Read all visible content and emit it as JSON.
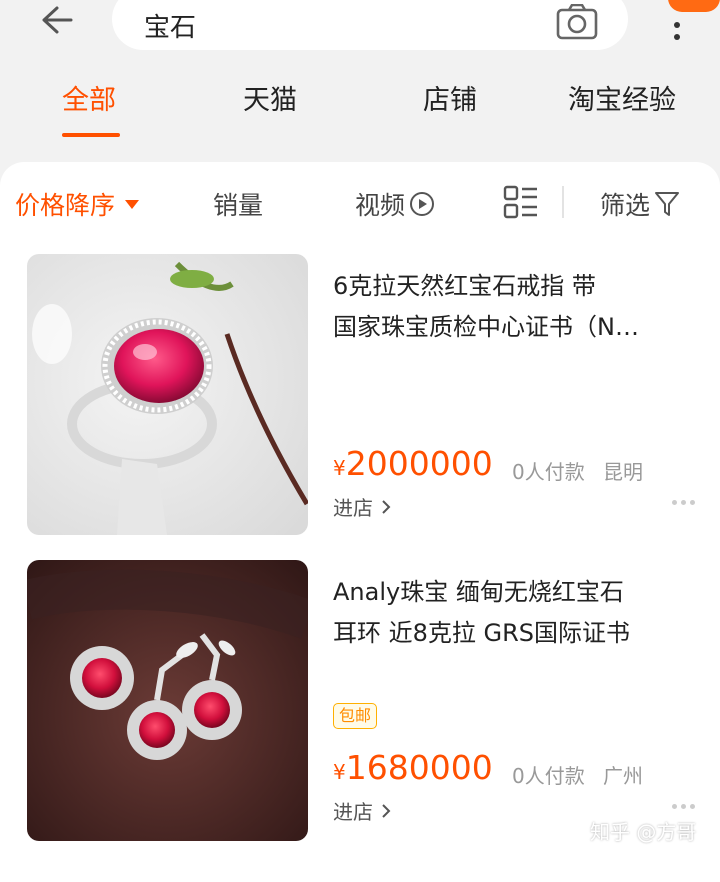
{
  "search": {
    "query": "宝石"
  },
  "icons": {
    "back": "arrow-left-icon",
    "camera": "camera-icon",
    "more": "more-vertical-icon",
    "video": "play-circle-icon",
    "layout": "list-grid-toggle-icon",
    "filter": "filter-funnel-icon"
  },
  "colors": {
    "accent": "#ff5000",
    "tag_border": "#ffb000"
  },
  "tabs": [
    {
      "label": "全部",
      "active": true
    },
    {
      "label": "天猫",
      "active": false
    },
    {
      "label": "店铺",
      "active": false
    },
    {
      "label": "淘宝经验",
      "active": false
    }
  ],
  "sort": {
    "price_desc": "价格降序",
    "sales": "销量",
    "video": "视频",
    "filter": "筛选"
  },
  "products": [
    {
      "title_line1": "6克拉天然红宝石戒指 带",
      "title_line2": "国家珠宝质检中心证书（N…",
      "tag": "",
      "currency": "¥",
      "price": "2000000",
      "sold": "0人付款",
      "location": "昆明",
      "store_link": "进店"
    },
    {
      "title_line1": "Analy珠宝 缅甸无烧红宝石",
      "title_line2": "耳环 近8克拉 GRS国际证书",
      "tag": "包邮",
      "currency": "¥",
      "price": "1680000",
      "sold": "0人付款",
      "location": "广州",
      "store_link": "进店"
    }
  ],
  "watermark": "知乎 @方哥"
}
